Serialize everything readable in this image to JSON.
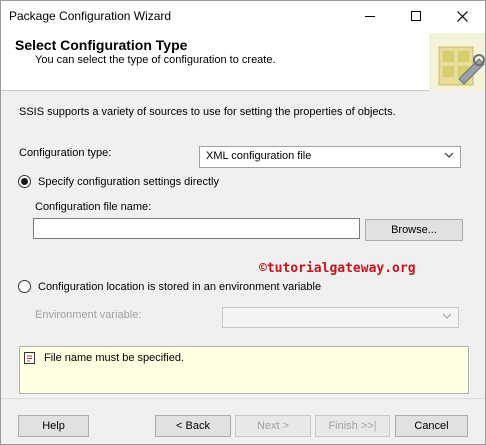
{
  "window": {
    "title": "Package Configuration Wizard"
  },
  "header": {
    "title": "Select Configuration Type",
    "subtitle": "You can select the type of configuration to create."
  },
  "content": {
    "intro": "SSIS supports a variety of sources to use for setting the properties of objects.",
    "configuration_type_label": "Configuration type:",
    "configuration_type_value": "XML configuration file",
    "option_direct_label": "Specify configuration settings directly",
    "option_direct_selected": true,
    "config_file_name_label": "Configuration file name:",
    "config_file_name_value": "",
    "browse_button": "Browse...",
    "watermark": "©tutorialgateway.org",
    "option_env_label": "Configuration location is stored in an environment variable",
    "option_env_selected": false,
    "env_var_label": "Environment variable:",
    "env_var_value": ""
  },
  "message": {
    "text": "File name must be specified.",
    "icon": "warning-icon"
  },
  "footer": {
    "help": "Help",
    "back": "< Back",
    "next": "Next >",
    "finish": "Finish >>|",
    "cancel": "Cancel"
  },
  "colors": {
    "message_bg": "#ffffe1",
    "watermark": "#c8141e",
    "window_bg": "#f0f0f0"
  }
}
